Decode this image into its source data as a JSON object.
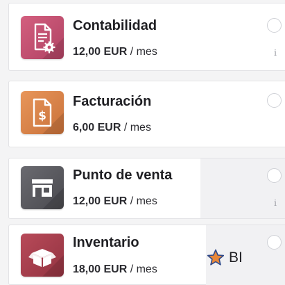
{
  "apps": [
    {
      "name": "Contabilidad",
      "price_amount": "12,00 EUR",
      "price_period": " / mes",
      "icon": "accounting-document-gear-icon",
      "icon_color": "#c2506f",
      "has_info": true
    },
    {
      "name": "Facturación",
      "price_amount": "6,00 EUR",
      "price_period": " / mes",
      "icon": "invoice-dollar-icon",
      "icon_color": "#d9834b",
      "has_info": false
    },
    {
      "name": "Punto de venta",
      "price_amount": "12,00 EUR",
      "price_period": " / mes",
      "icon": "storefront-icon",
      "icon_color": "#5a5a5f",
      "has_info": true
    },
    {
      "name": "Inventario",
      "price_amount": "18,00 EUR",
      "price_period": " / mes",
      "icon": "open-box-icon",
      "icon_color": "#a8404e",
      "has_info": false
    }
  ],
  "info_glyph": "i",
  "badge": {
    "icon": "star-icon",
    "icon_color": "#e8873a",
    "label": "BI"
  }
}
